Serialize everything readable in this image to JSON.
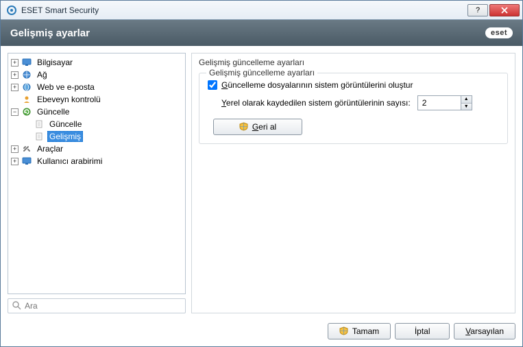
{
  "window": {
    "title": "ESET Smart Security"
  },
  "header": {
    "title": "Gelişmiş ayarlar",
    "logo": "eset"
  },
  "tree": {
    "bilgisayar": "Bilgisayar",
    "ag": "Ağ",
    "web": "Web ve e-posta",
    "ebeveyn": "Ebeveyn kontrolü",
    "guncelle": "Güncelle",
    "guncelle_child": "Güncelle",
    "gelismis": "Gelişmiş",
    "araclar": "Araçlar",
    "arabirim": "Kullanıcı arabirimi"
  },
  "search": {
    "placeholder": "Ara"
  },
  "panel": {
    "title": "Gelişmiş güncelleme ayarları",
    "group_legend": "Gelişmiş güncelleme ayarları",
    "checkbox_label": "Güncelleme dosyalarının sistem görüntülerini oluştur",
    "spinner_label": "Yerel olarak kaydedilen sistem görüntülerinin sayısı:",
    "spinner_value": "2",
    "rollback_btn": "Geri al"
  },
  "footer": {
    "ok": "Tamam",
    "cancel": "İptal",
    "default": "Varsayılan"
  }
}
